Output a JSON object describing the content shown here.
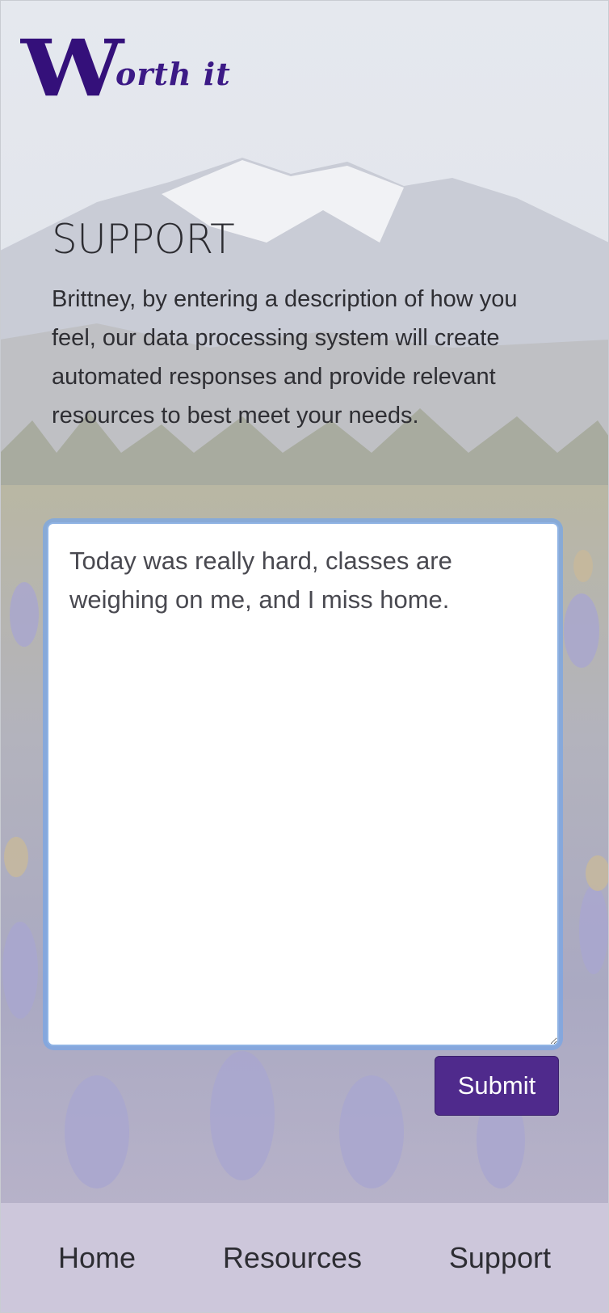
{
  "brand": {
    "logo_initial": "W",
    "logo_rest": "orth it",
    "logo_color": "#34107a"
  },
  "page": {
    "title": "SUPPORT",
    "description": "Brittney, by entering a description of how you feel, our data processing system will create automated responses and provide relevant resources to best meet your needs."
  },
  "form": {
    "textarea_value": "Today was really hard, classes are weighing on me, and I miss home.",
    "submit_label": "Submit",
    "accent": "#4f2a8c"
  },
  "footer": {
    "background": "#cdc7db",
    "links": [
      "Home",
      "Resources",
      "Support"
    ]
  }
}
